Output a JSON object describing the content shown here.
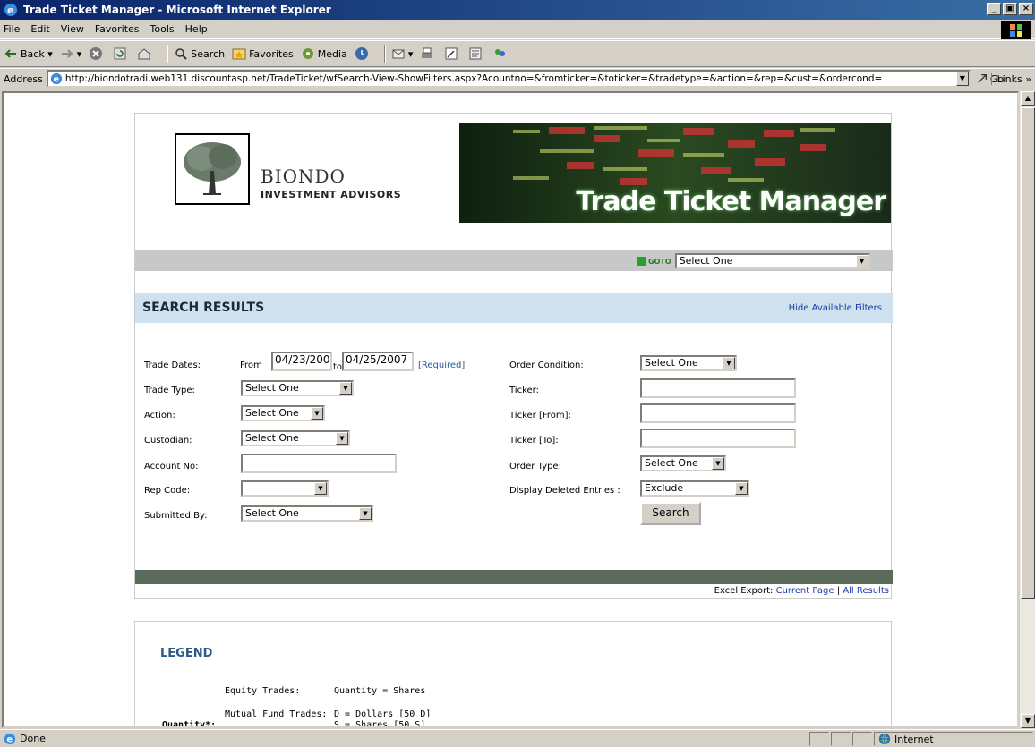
{
  "window": {
    "title": "Trade Ticket Manager - Microsoft Internet Explorer",
    "buttons": [
      "_",
      "×"
    ]
  },
  "menu": [
    "File",
    "Edit",
    "View",
    "Favorites",
    "Tools",
    "Help"
  ],
  "toolbar": {
    "back": "Back",
    "search": "Search",
    "favorites": "Favorites",
    "media": "Media"
  },
  "address": {
    "label": "Address",
    "url": "http://biondotradi.web131.discountasp.net/TradeTicket/wfSearch-View-ShowFilters.aspx?Acountno=&fromticker=&toticker=&tradetype=&action=&rep=&cust=&ordercond=",
    "go": "Go",
    "links": "Links"
  },
  "header": {
    "brand_line1": "BIONDO",
    "brand_line2": "INVESTMENT ADVISORS",
    "banner_title": "Trade Ticket Manager",
    "goto_label": "GOTO",
    "goto_select": "Select One"
  },
  "results": {
    "title": "SEARCH RESULTS",
    "hide_filters": "Hide Available Filters"
  },
  "filters": {
    "trade_dates_label": "Trade Dates:",
    "from_label": "From",
    "from_value": "04/23/200",
    "to_label": "to",
    "to_value": "04/25/2007",
    "required": "[Required]",
    "trade_type_label": "Trade Type:",
    "trade_type_value": "Select One",
    "action_label": "Action:",
    "action_value": "Select One",
    "custodian_label": "Custodian:",
    "custodian_value": "Select One",
    "account_label": "Account No:",
    "account_value": "",
    "rep_label": "Rep Code:",
    "rep_value": "",
    "submitted_label": "Submitted By:",
    "submitted_value": "Select One",
    "order_cond_label": "Order Condition:",
    "order_cond_value": "Select One",
    "ticker_label": "Ticker:",
    "ticker_value": "",
    "ticker_from_label": "Ticker [From]:",
    "ticker_from_value": "",
    "ticker_to_label": "Ticker [To]:",
    "ticker_to_value": "",
    "order_type_label": "Order Type:",
    "order_type_value": "Select One",
    "display_deleted_label": "Display Deleted Entries :",
    "display_deleted_value": "Exclude",
    "search_button": "Search"
  },
  "excel": {
    "label": "Excel Export:",
    "current_page": "Current Page",
    "separator": "|",
    "all_results": "All Results"
  },
  "legend": {
    "title": "LEGEND",
    "equity_label": "Equity Trades:",
    "equity_value": "Quantity = Shares",
    "mutual_label": "Mutual Fund Trades:",
    "mutual_value1": "D = Dollars [50 D]",
    "mutual_value2": "S = Shares [50 S]",
    "quantity_label": "Quantity*:"
  },
  "status": {
    "left": "Done",
    "zone": "Internet"
  },
  "colors": {
    "titlebar": "#0a246a",
    "results_bar": "#cfe0ef",
    "dark_band": "#5b6b5b",
    "link": "#1a3caa"
  }
}
